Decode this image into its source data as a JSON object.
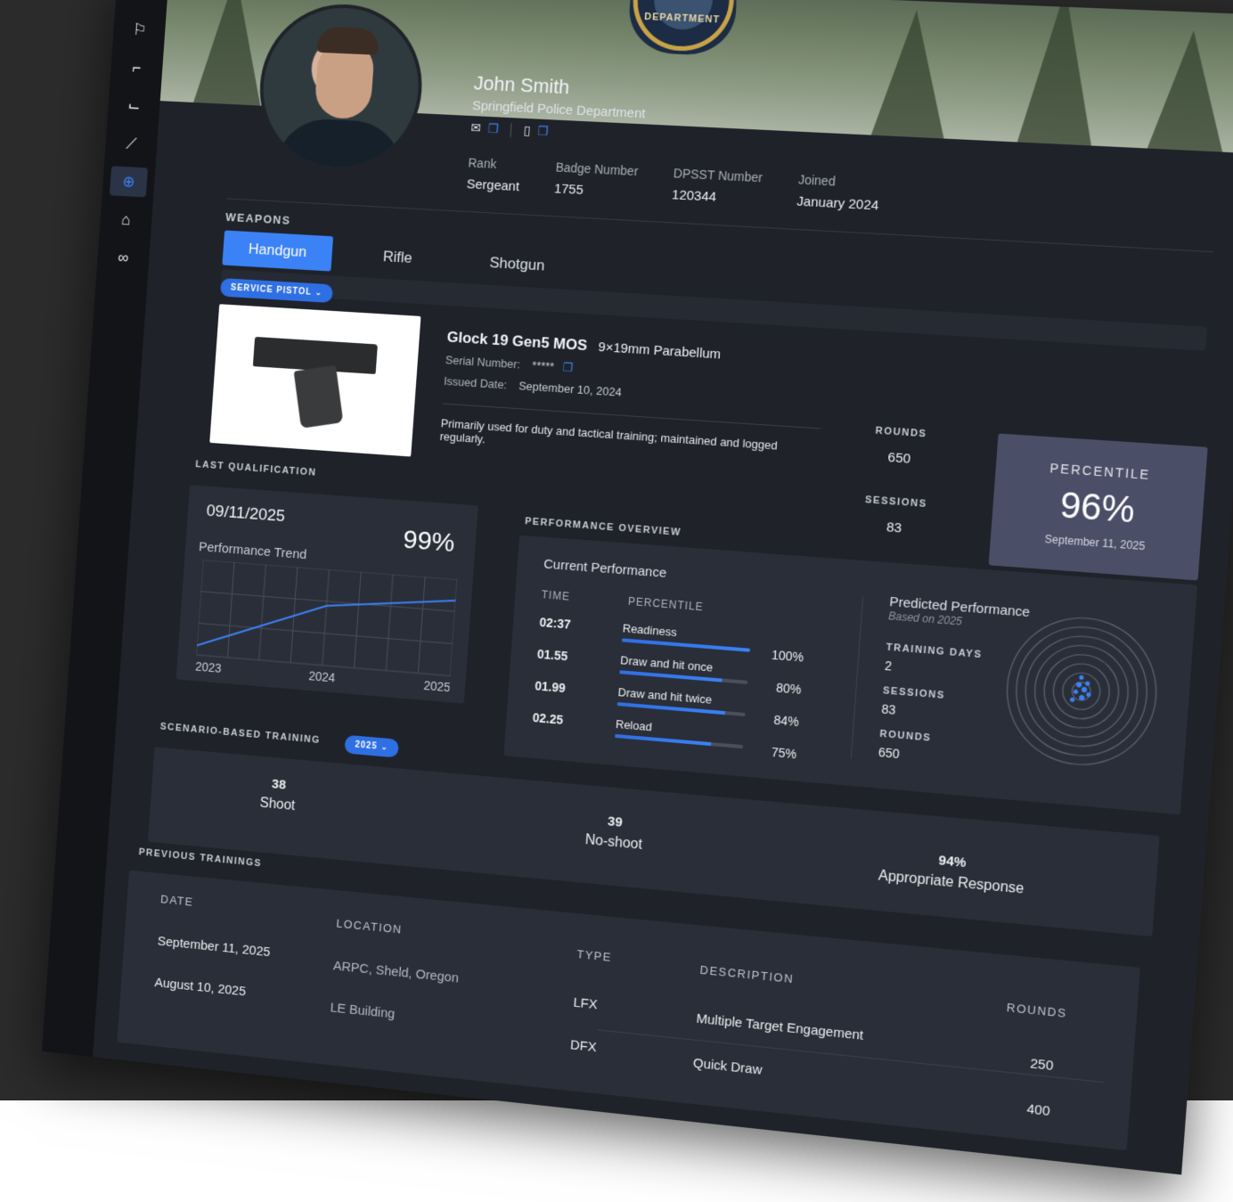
{
  "sidebar": {
    "items": [
      {
        "icon": "curve-arrow-icon",
        "glyph": "⤼"
      },
      {
        "icon": "door-icon",
        "glyph": "⚐"
      },
      {
        "icon": "handgun-icon",
        "glyph": "⌐"
      },
      {
        "icon": "boot-icon",
        "glyph": "⌙"
      },
      {
        "icon": "knife-icon",
        "glyph": "⟋"
      },
      {
        "icon": "target-icon",
        "glyph": "⊕",
        "active": true
      },
      {
        "icon": "lfx-house-icon",
        "glyph": "⌂"
      },
      {
        "icon": "rings-icon",
        "glyph": "∞"
      }
    ]
  },
  "banner": {
    "badge_text": "DEPARTMENT"
  },
  "profile": {
    "name": "John Smith",
    "department": "Springfield Police Department",
    "rank_label": "Rank",
    "rank": "Sergeant",
    "badge_label": "Badge Number",
    "badge": "1755",
    "dpsst_label": "DPSST Number",
    "dpsst": "120344",
    "joined_label": "Joined",
    "joined": "January 2024"
  },
  "weapons": {
    "section_label": "WEAPONS",
    "tabs": [
      "Handgun",
      "Rifle",
      "Shotgun"
    ],
    "active_tab": "Handgun",
    "category_pill": "SERVICE PISTOL",
    "model": "Glock 19 Gen5 MOS",
    "caliber": "9×19mm Parabellum",
    "serial_label": "Serial Number:",
    "serial": "*****",
    "issued_label": "Issued Date:",
    "issued": "September 10, 2024",
    "description": "Primarily used for duty and tactical training; maintained and logged regularly.",
    "rounds_label": "ROUNDS",
    "rounds": "650",
    "sessions_label": "SESSIONS",
    "sessions": "83",
    "percentile_label": "PERCENTILE",
    "percentile": "96%",
    "percentile_date": "September 11, 2025"
  },
  "qualification": {
    "section_label": "LAST QUALIFICATION",
    "date": "09/11/2025",
    "score": "99%",
    "trend_label": "Performance Trend",
    "x_labels": [
      "2023",
      "2024",
      "2025"
    ]
  },
  "chart_data": {
    "type": "line",
    "title": "Performance Trend",
    "x": [
      "2023",
      "2024",
      "2025"
    ],
    "series": [
      {
        "values": [
          10,
          62,
          78
        ]
      }
    ],
    "ylim": [
      0,
      100
    ],
    "grid": true
  },
  "performance": {
    "section_label": "PERFORMANCE OVERVIEW",
    "current_label": "Current Performance",
    "time_col": "TIME",
    "pct_col": "PERCENTILE",
    "rows": [
      {
        "time": "02:37",
        "label": "Readiness",
        "value": "100%",
        "fill": 1.0
      },
      {
        "time": "01.55",
        "label": "Draw and hit once",
        "value": "80%",
        "fill": 0.8
      },
      {
        "time": "01.99",
        "label": "Draw and hit twice",
        "value": "84%",
        "fill": 0.84
      },
      {
        "time": "02.25",
        "label": "Reload",
        "value": "75%",
        "fill": 0.75
      }
    ],
    "predicted_label": "Predicted Performance",
    "predicted_sub": "Based on 2025",
    "training_days_label": "TRAINING DAYS",
    "training_days": "2",
    "sessions_label": "SESSIONS",
    "sessions": "83",
    "rounds_label": "ROUNDS",
    "rounds": "650"
  },
  "scenario": {
    "section_label": "SCENARIO-BASED TRAINING",
    "year_pill": "2025",
    "items": [
      {
        "value": "38",
        "label": "Shoot"
      },
      {
        "value": "39",
        "label": "No-shoot"
      },
      {
        "value": "94%",
        "label": "Appropriate Response"
      }
    ]
  },
  "previous": {
    "section_label": "PREVIOUS TRAININGS",
    "headers": {
      "date": "DATE",
      "location": "LOCATION",
      "type": "TYPE",
      "description": "DESCRIPTION",
      "rounds": "ROUNDS"
    },
    "rows": [
      {
        "date": "September 11, 2025",
        "location": "ARPC, Sheld, Oregon",
        "type": "LFX",
        "description": "Multiple Target Engagement",
        "rounds": "250"
      },
      {
        "date": "August 10, 2025",
        "location": "LE Building",
        "type": "DFX",
        "description": "Quick Draw",
        "rounds": "400"
      }
    ]
  },
  "colors": {
    "accent": "#3b82f6",
    "background": "#1f2229",
    "card": "#2a2e38",
    "percentile_card": "#4a4f67"
  }
}
